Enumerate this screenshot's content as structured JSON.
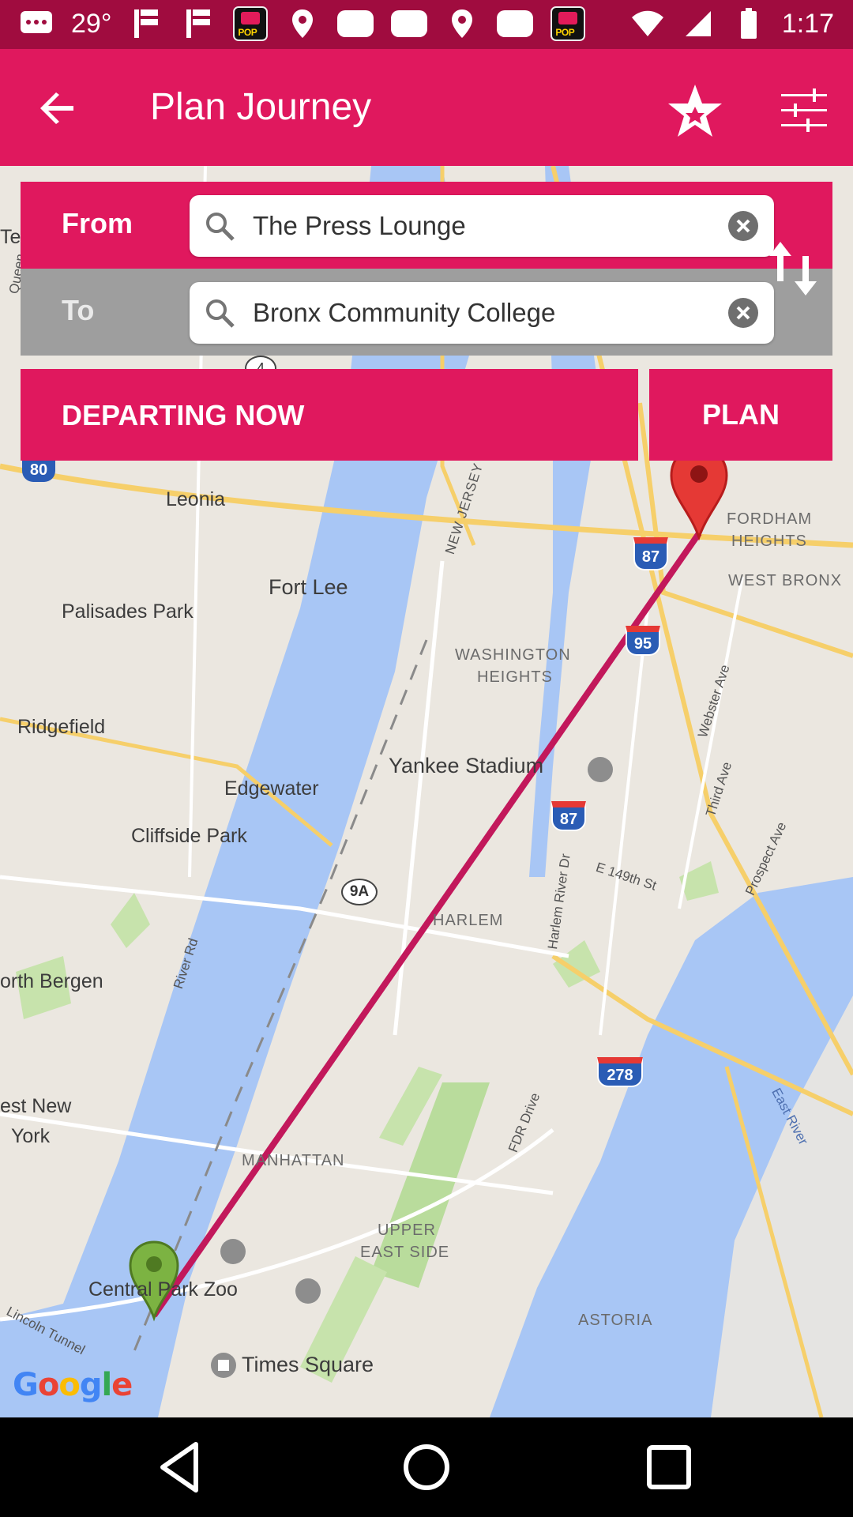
{
  "status_bar": {
    "temperature": "29°",
    "time": "1:17",
    "pop_text": "POP"
  },
  "header": {
    "title": "Plan Journey",
    "icons": [
      "back-arrow-icon",
      "star-icon",
      "filter-sliders-icon"
    ]
  },
  "journey": {
    "from_label": "From",
    "from_value": "The Press Lounge",
    "to_label": "To",
    "to_value": "Bronx Community College",
    "depart_label": "DEPARTING NOW",
    "plan_label": "PLAN"
  },
  "map": {
    "labels": {
      "leonia": "Leonia",
      "fordham": "FORDHAM",
      "heights": "HEIGHTS",
      "west_bronx": "WEST BRONX",
      "fort_lee": "Fort Lee",
      "palisades_park": "Palisades Park",
      "washington": "WASHINGTON",
      "washington_heights": "HEIGHTS",
      "ridgefield": "Ridgefield",
      "yankee_stadium": "Yankee Stadium",
      "edgewater": "Edgewater",
      "cliffside_park": "Cliffside Park",
      "harlem": "HARLEM",
      "north_bergen": "orth Bergen",
      "west_new": "est New",
      "york": "York",
      "manhattan": "MANHATTAN",
      "upper": "UPPER",
      "east_side": "EAST SIDE",
      "central_park_zoo": "Central Park Zoo",
      "times_square": "Times Square",
      "astoria": "ASTORIA",
      "webster_ave": "Webster Ave",
      "third_ave": "Third Ave",
      "prospect_ave": "Prospect Ave",
      "e149th": "E 149th St",
      "harlem_river_dr": "Harlem River Dr",
      "fdr_drive": "FDR Drive",
      "river_rd": "River Rd",
      "east_river": "East River",
      "lincoln_tunnel": "Lincoln Tunnel",
      "new_jersey_tpke": "NEW JERSEY TPKE",
      "queens": "Queen",
      "te": "Te",
      "shield_80": "80",
      "shield_87": "87",
      "shield_95": "95",
      "shield_87b": "87",
      "shield_9a": "9A",
      "shield_278": "278",
      "shield_4": "4"
    },
    "google": [
      "G",
      "o",
      "o",
      "g",
      "l",
      "e"
    ],
    "google_colors": [
      "#4285F4",
      "#EA4335",
      "#FBBC05",
      "#4285F4",
      "#34A853",
      "#EA4335"
    ],
    "route_color": "#c2185b",
    "origin_pin_color": "#7cb342",
    "destination_pin_color": "#e53935"
  },
  "nav_bar": {
    "icons": [
      "back-triangle-icon",
      "home-circle-icon",
      "recents-square-icon"
    ]
  },
  "colors": {
    "primary": "#e0185e",
    "status_bar": "#a00c3f",
    "to_row": "#9e9e9e"
  }
}
